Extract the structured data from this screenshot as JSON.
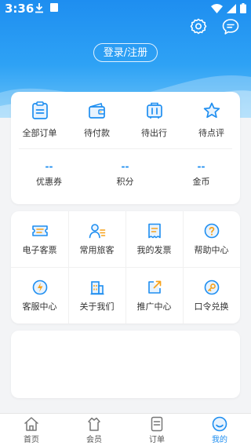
{
  "status_bar": {
    "time": "3:36"
  },
  "header": {
    "login_label": "登录/注册"
  },
  "orders": [
    {
      "label": "全部订单",
      "icon": "clipboard-icon"
    },
    {
      "label": "待付款",
      "icon": "wallet-icon"
    },
    {
      "label": "待出行",
      "icon": "luggage-icon"
    },
    {
      "label": "待点评",
      "icon": "star-icon"
    }
  ],
  "stats": [
    {
      "value": "--",
      "label": "优惠券"
    },
    {
      "value": "--",
      "label": "积分"
    },
    {
      "value": "--",
      "label": "金币"
    }
  ],
  "services": [
    {
      "label": "电子客票",
      "icon": "ticket-icon"
    },
    {
      "label": "常用旅客",
      "icon": "passenger-icon"
    },
    {
      "label": "我的发票",
      "icon": "invoice-icon"
    },
    {
      "label": "帮助中心",
      "icon": "help-icon"
    },
    {
      "label": "客服中心",
      "icon": "service-icon"
    },
    {
      "label": "关于我们",
      "icon": "building-icon"
    },
    {
      "label": "推广中心",
      "icon": "share-icon"
    },
    {
      "label": "口令兑换",
      "icon": "key-icon"
    }
  ],
  "tabbar": [
    {
      "label": "首页",
      "icon": "home-icon"
    },
    {
      "label": "会员",
      "icon": "member-icon"
    },
    {
      "label": "订单",
      "icon": "orders-icon"
    },
    {
      "label": "我的",
      "icon": "profile-icon",
      "active": true
    }
  ],
  "colors": {
    "accent": "#1e8ef0",
    "orange": "#f7a21b",
    "background": "#f3f4f6"
  }
}
